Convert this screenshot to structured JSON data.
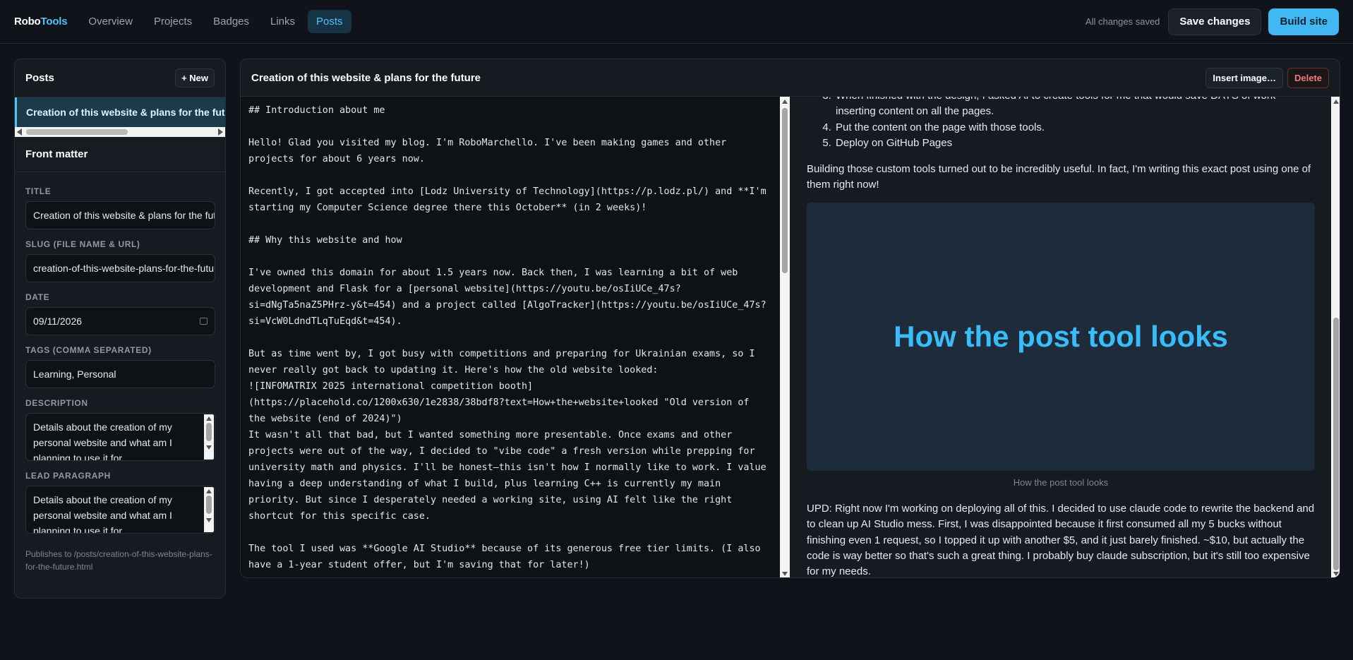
{
  "brand": {
    "part1": "Robo",
    "part2": "Tools"
  },
  "nav": [
    "Overview",
    "Projects",
    "Badges",
    "Links",
    "Posts"
  ],
  "nav_active": "Posts",
  "status": "All changes saved",
  "actions": {
    "save": "Save changes",
    "build": "Build site"
  },
  "sidebar": {
    "title": "Posts",
    "new_label": "+ New",
    "posts": [
      "Creation of this website & plans for the future"
    ],
    "front_matter_title": "Front matter",
    "fields": {
      "title_label": "TITLE",
      "title_value": "Creation of this website & plans for the future",
      "slug_label": "SLUG (FILE NAME & URL)",
      "slug_value": "creation-of-this-website-plans-for-the-future",
      "date_label": "DATE",
      "date_value": "09/11/2026",
      "tags_label": "TAGS (COMMA SEPARATED)",
      "tags_value": "Learning, Personal",
      "description_label": "DESCRIPTION",
      "description_value": "Details about the creation of my personal website and what am I planning to use it for.",
      "lead_label": "LEAD PARAGRAPH",
      "lead_value": "Details about the creation of my personal website and what am I planning to use it for."
    },
    "publish_note": "Publishes to /posts/creation-of-this-website-plans-for-the-future.html"
  },
  "editor": {
    "title": "Creation of this website & plans for the future",
    "insert_label": "Insert image…",
    "delete_label": "Delete",
    "markdown": "## Introduction about me\n\nHello! Glad you visited my blog. I'm RoboMarchello. I've been making games and other projects for about 6 years now.\n\nRecently, I got accepted into [Lodz University of Technology](https://p.lodz.pl/) and **I'm starting my Computer Science degree there this October** (in 2 weeks)!\n\n## Why this website and how\n\nI've owned this domain for about 1.5 years now. Back then, I was learning a bit of web development and Flask for a [personal website](https://youtu.be/osIiUCe_47s?si=dNgTa5naZ5PHrz-y&t=454) and a project called [AlgoTracker](https://youtu.be/osIiUCe_47s?si=VcW0LdndTLqTuEqd&t=454).\n\nBut as time went by, I got busy with competitions and preparing for Ukrainian exams, so I never really got back to updating it. Here's how the old website looked:\n![INFOMATRIX 2025 international competition booth]\n(https://placehold.co/1200x630/1e2838/38bdf8?text=How+the+website+looked \"Old version of the website (end of 2024)\")\nIt wasn't all that bad, but I wanted something more presentable. Once exams and other projects were out of the way, I decided to \"vibe code\" a fresh version while prepping for university math and physics. I'll be honest—this isn't how I normally like to work. I value having a deep understanding of what I build, plus learning C++ is currently my main priority. But since I desperately needed a working site, using AI felt like the right shortcut for this specific case.\n\nThe tool I used was **Google AI Studio** because of its generous free tier limits. (I also have a 1-year student offer, but I'm saving that for later!)"
  },
  "preview": {
    "list_start": 3,
    "list": [
      "When finished with the design, I asked AI to create tools for me that would save DAYS of work inserting content on all the pages.",
      "Put the content on the page with those tools.",
      "Deploy on GitHub Pages"
    ],
    "para1": "Building those custom tools turned out to be incredibly useful. In fact, I'm writing this exact post using one of them right now!",
    "image_text": "How the post tool looks",
    "caption": "How the post tool looks",
    "para2": "UPD: Right now I'm working on deploying all of this. I decided to use claude code to rewrite the backend and to clean up AI Studio mess. First, I was disappointed because it first consumed all my 5 bucks without finishing even 1 request, so I topped it up with another $5, and it just barely finished. ~$10, but actually the code is way better so that's such a great thing. I probably buy claude subscription, but it's still too expensive for my needs."
  }
}
